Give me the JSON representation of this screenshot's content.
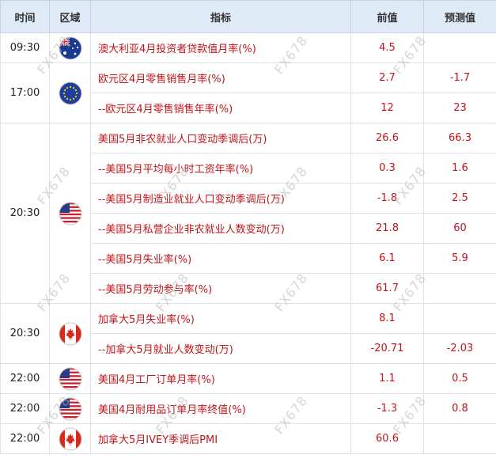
{
  "header": {
    "time": "时间",
    "region": "区域",
    "indicator": "指标",
    "previous": "前值",
    "forecast": "预测值"
  },
  "groups": [
    {
      "time": "09:30",
      "flag": "australia-flag-icon"
    },
    {
      "time": "17:00",
      "flag": "eu-flag-icon"
    },
    {
      "time": "20:30",
      "flag": "usa-flag-icon"
    },
    {
      "time": "20:30",
      "flag": "canada-flag-icon"
    },
    {
      "time": "22:00",
      "flag": "usa-flag-icon"
    },
    {
      "time": "22:00",
      "flag": "usa-flag-icon"
    },
    {
      "time": "22:00",
      "flag": "canada-flag-icon"
    }
  ],
  "rows": [
    {
      "indicator": "澳大利亚4月投资者贷款值月率(%)",
      "previous": "4.5",
      "forecast": ""
    },
    {
      "indicator": "欧元区4月零售销售月率(%)",
      "previous": "2.7",
      "forecast": "-1.7"
    },
    {
      "indicator": "--欧元区4月零售销售年率(%)",
      "previous": "12",
      "forecast": "23"
    },
    {
      "indicator": "美国5月非农就业人口变动季调后(万)",
      "previous": "26.6",
      "forecast": "66.3"
    },
    {
      "indicator": "--美国5月平均每小时工资年率(%)",
      "previous": "0.3",
      "forecast": "1.6"
    },
    {
      "indicator": "--美国5月制造业就业人口变动季调后(万)",
      "previous": "-1.8",
      "forecast": "2.5"
    },
    {
      "indicator": "--美国5月私营企业非农就业人数变动(万)",
      "previous": "21.8",
      "forecast": "60"
    },
    {
      "indicator": "--美国5月失业率(%)",
      "previous": "6.1",
      "forecast": "5.9"
    },
    {
      "indicator": "--美国5月劳动参与率(%)",
      "previous": "61.7",
      "forecast": ""
    },
    {
      "indicator": "加拿大5月失业率(%)",
      "previous": "8.1",
      "forecast": ""
    },
    {
      "indicator": "--加拿大5月就业人数变动(万)",
      "previous": "-20.71",
      "forecast": "-2.03"
    },
    {
      "indicator": "美国4月工厂订单月率(%)",
      "previous": "1.1",
      "forecast": "0.5"
    },
    {
      "indicator": "美国4月耐用品订单月率终值(%)",
      "previous": "-1.3",
      "forecast": "0.8"
    },
    {
      "indicator": "加拿大5月IVEY季调后PMI",
      "previous": "60.6",
      "forecast": ""
    }
  ],
  "watermark": "FX678"
}
